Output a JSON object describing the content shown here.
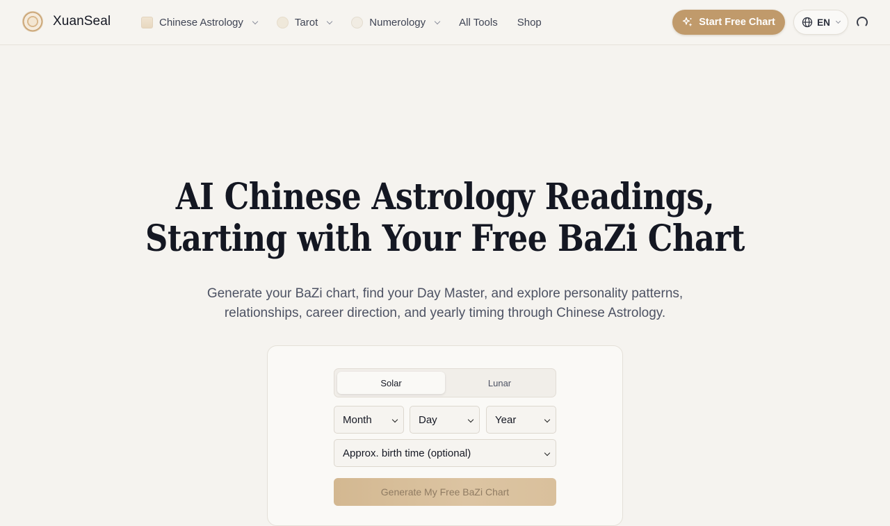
{
  "brand": {
    "name": "XuanSeal"
  },
  "nav": {
    "items": [
      {
        "label": "Chinese Astrology",
        "icon": "astrology-thumbnail",
        "dropdown": true
      },
      {
        "label": "Tarot",
        "icon": "tarot-thumbnail",
        "dropdown": true
      },
      {
        "label": "Numerology",
        "icon": "numerology-thumbnail",
        "dropdown": true
      },
      {
        "label": "All Tools",
        "dropdown": false
      },
      {
        "label": "Shop",
        "dropdown": false
      }
    ]
  },
  "header": {
    "cta_label": "Start Free Chart",
    "cta_icon": "sparkles-icon",
    "language": "EN",
    "language_icon": "globe-icon"
  },
  "hero": {
    "title_line1": "AI Chinese Astrology Readings,",
    "title_line2": "Starting with Your Free BaZi Chart",
    "subtitle_line1": "Generate your BaZi chart, find your Day Master, and explore personality patterns,",
    "subtitle_line2": "relationships, career direction, and yearly timing through Chinese Astrology."
  },
  "form": {
    "calendar_options": [
      "Solar",
      "Lunar"
    ],
    "selected_calendar": "Solar",
    "month_select": "Month",
    "day_select": "Day",
    "year_select": "Year",
    "time_select": "Approx. birth time (optional)",
    "submit_label": "Generate My Free BaZi Chart"
  },
  "colors": {
    "accent": "#c09a6b",
    "background": "#f5f3ef",
    "text": "#141722"
  }
}
